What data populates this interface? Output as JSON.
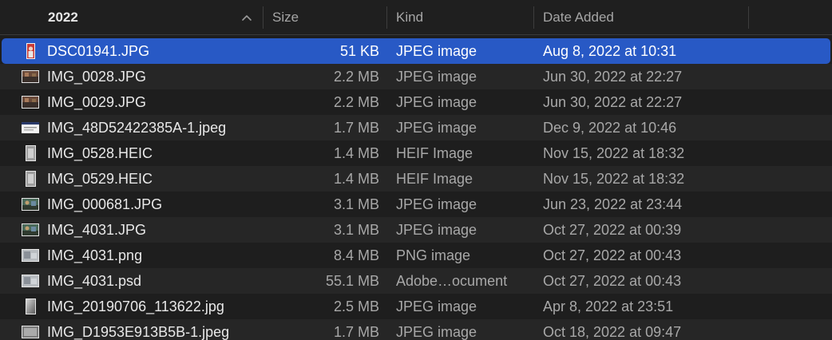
{
  "header": {
    "name_label": "2022",
    "size_label": "Size",
    "kind_label": "Kind",
    "date_label": "Date Added",
    "sort_icon": "chevron-up-icon"
  },
  "files": [
    {
      "name": "DSC01941.JPG",
      "size": "51 KB",
      "kind": "JPEG image",
      "date": "Aug 8, 2022 at 10:31",
      "thumb": "portrait-red",
      "selected": true
    },
    {
      "name": "IMG_0028.JPG",
      "size": "2.2 MB",
      "kind": "JPEG image",
      "date": "Jun 30, 2022 at 22:27",
      "thumb": "landscape-dark"
    },
    {
      "name": "IMG_0029.JPG",
      "size": "2.2 MB",
      "kind": "JPEG image",
      "date": "Jun 30, 2022 at 22:27",
      "thumb": "landscape-dark"
    },
    {
      "name": "IMG_48D52422385A-1.jpeg",
      "size": "1.7 MB",
      "kind": "JPEG image",
      "date": "Dec 9, 2022 at 10:46",
      "thumb": "document-wide"
    },
    {
      "name": "IMG_0528.HEIC",
      "size": "1.4 MB",
      "kind": "HEIF Image",
      "date": "Nov 15, 2022 at 18:32",
      "thumb": "portrait-gray"
    },
    {
      "name": "IMG_0529.HEIC",
      "size": "1.4 MB",
      "kind": "HEIF Image",
      "date": "Nov 15, 2022 at 18:32",
      "thumb": "portrait-gray"
    },
    {
      "name": "IMG_000681.JPG",
      "size": "3.1 MB",
      "kind": "JPEG image",
      "date": "Jun 23, 2022 at 23:44",
      "thumb": "landscape-scene"
    },
    {
      "name": "IMG_4031.JPG",
      "size": "3.1 MB",
      "kind": "JPEG image",
      "date": "Oct 27, 2022 at 00:39",
      "thumb": "landscape-scene"
    },
    {
      "name": "IMG_4031.png",
      "size": "8.4 MB",
      "kind": "PNG image",
      "date": "Oct 27, 2022 at 00:43",
      "thumb": "landscape-light"
    },
    {
      "name": "IMG_4031.psd",
      "size": "55.1 MB",
      "kind": "Adobe…ocument",
      "date": "Oct 27, 2022 at 00:43",
      "thumb": "landscape-light"
    },
    {
      "name": "IMG_20190706_113622.jpg",
      "size": "2.5 MB",
      "kind": "JPEG image",
      "date": "Apr 8, 2022 at 23:51",
      "thumb": "portrait-gradient"
    },
    {
      "name": "IMG_D1953E913B5B-1.jpeg",
      "size": "1.7 MB",
      "kind": "JPEG image",
      "date": "Oct 18, 2022 at 09:47",
      "thumb": "landscape-gray"
    }
  ]
}
